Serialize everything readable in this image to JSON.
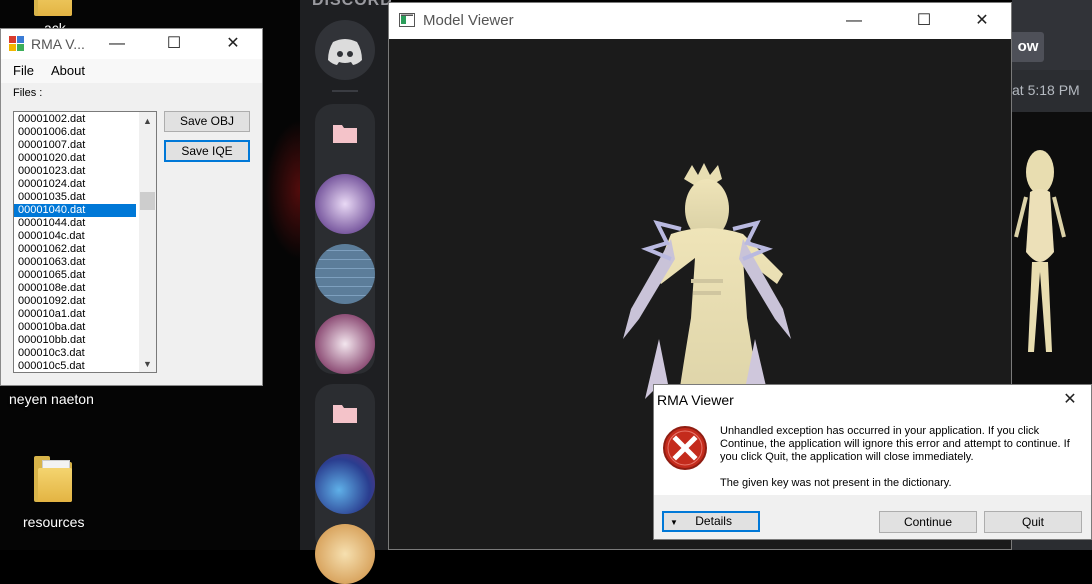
{
  "desktop": {
    "top_icon_label": "ack",
    "label_above": "neyen naeton",
    "folder_label": "resources"
  },
  "discord": {
    "logo_text": "DISCORD",
    "button_text": "ow",
    "timestamp": "at 5:18 PM"
  },
  "model_viewer": {
    "title": "Model Viewer"
  },
  "rma_window": {
    "title": "RMA V...",
    "menu": [
      "File",
      "About"
    ],
    "files_label": "Files :",
    "files": [
      "00001002.dat",
      "00001006.dat",
      "00001007.dat",
      "00001020.dat",
      "00001023.dat",
      "00001024.dat",
      "00001035.dat",
      "00001040.dat",
      "00001044.dat",
      "0000104c.dat",
      "00001062.dat",
      "00001063.dat",
      "00001065.dat",
      "0000108e.dat",
      "00001092.dat",
      "000010a1.dat",
      "000010ba.dat",
      "000010bb.dat",
      "000010c3.dat",
      "000010c5.dat"
    ],
    "selected_file": "00001040.dat",
    "save_obj_label": "Save OBJ",
    "save_iqe_label": "Save IQE"
  },
  "dialog": {
    "title": "RMA Viewer",
    "message": "Unhandled exception has occurred in your application. If you click Continue, the application will ignore this error and attempt to continue. If you click Quit, the application will close immediately.",
    "detail": "The given key was not present in the dictionary.",
    "details_label": "Details",
    "continue_label": "Continue",
    "quit_label": "Quit"
  },
  "colors": {
    "accent": "#0078d7",
    "error_red": "#c42b1c",
    "discord_bg": "#1e1f22"
  }
}
